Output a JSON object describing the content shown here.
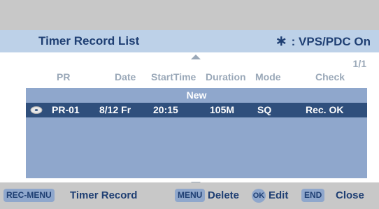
{
  "header": {
    "title": "Timer Record List",
    "vps_star": "∗",
    "vps_label": ": VPS/PDC On"
  },
  "list": {
    "page_indicator": "1/1",
    "columns": [
      "PR",
      "Date",
      "StartTime",
      "Duration",
      "Mode",
      "Check"
    ],
    "new_label": "New",
    "rows": [
      {
        "icon": "disc-icon",
        "pr": "PR-01",
        "date": "8/12 Fr",
        "start_time": "20:15",
        "duration": "105M",
        "mode": "SQ",
        "check": "Rec. OK"
      }
    ]
  },
  "footer": {
    "rec_menu_key": "REC-MENU",
    "rec_menu_label": "Timer Record",
    "menu_key": "MENU",
    "menu_label": "Delete",
    "ok_key": "OK",
    "ok_label": "Edit",
    "end_key": "END",
    "end_label": "Close"
  },
  "colors": {
    "title_bar": "#bdd1e8",
    "text_dark_blue": "#1f3f73",
    "list_area": "#8fa7cc",
    "selected_row": "#2f4f7c",
    "header_gray": "#9aa8b8"
  }
}
